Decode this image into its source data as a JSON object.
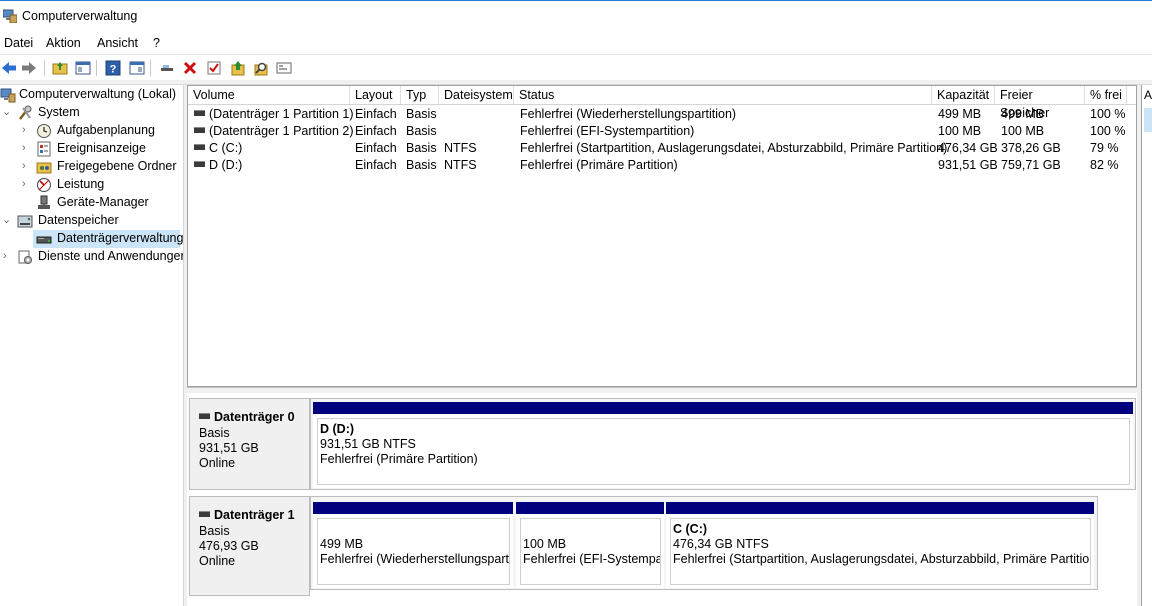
{
  "window": {
    "title": "Computerverwaltung"
  },
  "menu": [
    "Datei",
    "Aktion",
    "Ansicht",
    "?"
  ],
  "toolbar": {
    "icons": [
      "back-icon",
      "forward-icon",
      "up-folder-icon",
      "show-hide-tree-icon",
      "help-icon",
      "show-hide-action-pane-icon",
      "connect-icon",
      "delete-icon",
      "properties-icon",
      "up-arrow-icon",
      "search-icon",
      "console-icon"
    ]
  },
  "tree": {
    "root": "Computerverwaltung (Lokal)",
    "system": "System",
    "aufgaben": "Aufgabenplanung",
    "ereignis": "Ereignisanzeige",
    "freigegeben": "Freigegebene Ordner",
    "leistung": "Leistung",
    "geraete": "Geräte-Manager",
    "datenspeicher": "Datenspeicher",
    "datentraeger": "Datenträgerverwaltung",
    "dienste": "Dienste und Anwendungen"
  },
  "columns": [
    "Volume",
    "Layout",
    "Typ",
    "Dateisystem",
    "Status",
    "Kapazität",
    "Freier Speicher",
    "% frei"
  ],
  "volumes": [
    {
      "volume": "(Datenträger 1 Partition 1)",
      "layout": "Einfach",
      "typ": "Basis",
      "fs": "",
      "status": "Fehlerfrei (Wiederherstellungspartition)",
      "cap": "499 MB",
      "free": "499 MB",
      "pct": "100 %"
    },
    {
      "volume": "(Datenträger 1 Partition 2)",
      "layout": "Einfach",
      "typ": "Basis",
      "fs": "",
      "status": "Fehlerfrei (EFI-Systempartition)",
      "cap": "100 MB",
      "free": "100 MB",
      "pct": "100 %"
    },
    {
      "volume": "C (C:)",
      "layout": "Einfach",
      "typ": "Basis",
      "fs": "NTFS",
      "status": "Fehlerfrei (Startpartition, Auslagerungsdatei, Absturzabbild, Primäre Partition)",
      "cap": "476,34 GB",
      "free": "378,26 GB",
      "pct": "79 %"
    },
    {
      "volume": "D (D:)",
      "layout": "Einfach",
      "typ": "Basis",
      "fs": "NTFS",
      "status": "Fehlerfrei (Primäre Partition)",
      "cap": "931,51 GB",
      "free": "759,71 GB",
      "pct": "82 %"
    }
  ],
  "disk0": {
    "name": "Datenträger 0",
    "type": "Basis",
    "size": "931,51 GB",
    "state": "Online",
    "partitions": [
      {
        "title": "D  (D:)",
        "size": "931,51 GB NTFS",
        "status": "Fehlerfrei (Primäre Partition)"
      }
    ]
  },
  "disk1": {
    "name": "Datenträger 1",
    "type": "Basis",
    "size": "476,93 GB",
    "state": "Online",
    "partitions": [
      {
        "title": "",
        "size": "499 MB",
        "status": "Fehlerfrei (Wiederherstellungspartiti"
      },
      {
        "title": "",
        "size": "100 MB",
        "status": "Fehlerfrei (EFI-Systempart"
      },
      {
        "title": "C  (C:)",
        "size": "476,34 GB NTFS",
        "status": "Fehlerfrei (Startpartition, Auslagerungsdatei, Absturzabbild, Primäre Partition)"
      }
    ]
  },
  "action_pane": {
    "label": "A"
  },
  "colors": {
    "partition_bar": "#00007f",
    "selection": "#cce4f7"
  }
}
